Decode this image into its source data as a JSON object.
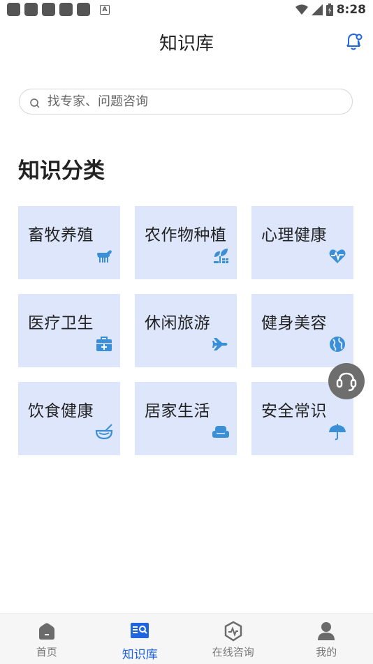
{
  "status_bar": {
    "time": "8:28",
    "notif_letter": "A"
  },
  "header": {
    "title": "知识库",
    "bell_icon": "bell-icon"
  },
  "search": {
    "placeholder": "找专家、问题咨询"
  },
  "section": {
    "title": "知识分类"
  },
  "categories": [
    {
      "label": "畜牧养殖",
      "icon": "goat-icon"
    },
    {
      "label": "农作物种植",
      "icon": "plant-icon"
    },
    {
      "label": "心理健康",
      "icon": "heart-pulse-icon"
    },
    {
      "label": "医疗卫生",
      "icon": "medical-kit-icon"
    },
    {
      "label": "休闲旅游",
      "icon": "airplane-icon"
    },
    {
      "label": "健身美容",
      "icon": "globe-icon"
    },
    {
      "label": "饮食健康",
      "icon": "bowl-icon"
    },
    {
      "label": "居家生活",
      "icon": "sofa-icon"
    },
    {
      "label": "安全常识",
      "icon": "umbrella-icon"
    }
  ],
  "bottom_nav": [
    {
      "label": "首页",
      "icon": "home-icon"
    },
    {
      "label": "知识库",
      "icon": "book-search-icon",
      "active": true
    },
    {
      "label": "在线咨询",
      "icon": "consult-icon"
    },
    {
      "label": "我的",
      "icon": "user-icon"
    }
  ],
  "colors": {
    "accent": "#1f64e0",
    "card_bg": "#dde6fb",
    "icon_blue": "#3a8fd6"
  }
}
